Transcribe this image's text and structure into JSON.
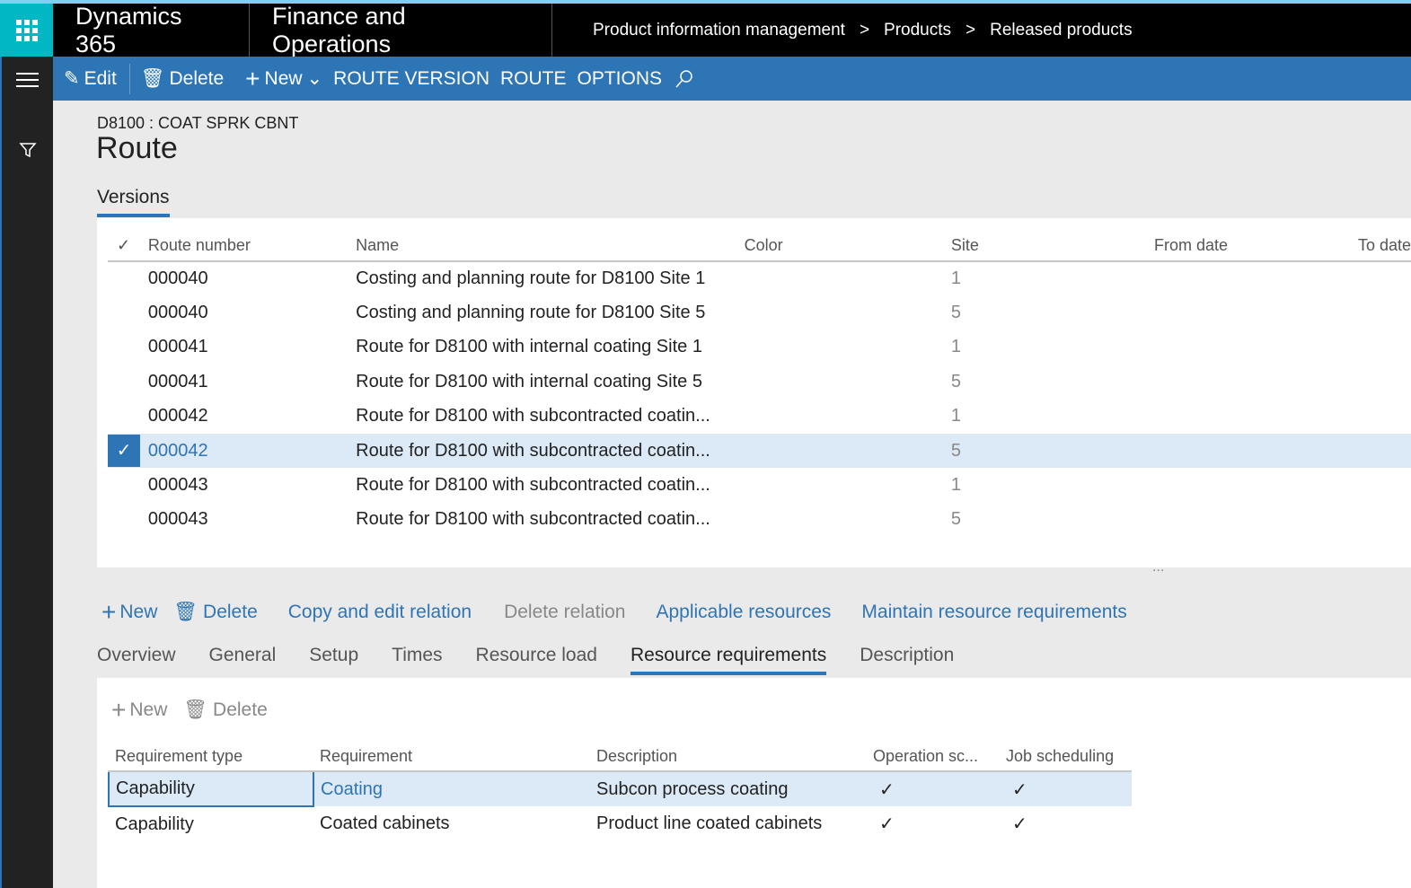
{
  "topbar": {
    "app": "Dynamics 365",
    "module": "Finance and Operations",
    "breadcrumbs": [
      "Product information management",
      "Products",
      "Released products"
    ]
  },
  "actionbar": {
    "edit": "Edit",
    "delete": "Delete",
    "new": "New",
    "route_version": "ROUTE VERSION",
    "route": "ROUTE",
    "options": "OPTIONS"
  },
  "page": {
    "record": "D8100 : COAT SPRK CBNT",
    "title": "Route",
    "section": "Versions"
  },
  "versions": {
    "columns": [
      "Route number",
      "Name",
      "Color",
      "Site",
      "From date",
      "To date"
    ],
    "rows": [
      {
        "number": "000040",
        "name": "Costing and planning route for D8100 Site 1",
        "site": "1"
      },
      {
        "number": "000040",
        "name": "Costing and planning route for D8100 Site 5",
        "site": "5"
      },
      {
        "number": "000041",
        "name": "Route for D8100 with internal coating Site 1",
        "site": "1"
      },
      {
        "number": "000041",
        "name": "Route for D8100 with internal coating Site 5",
        "site": "5"
      },
      {
        "number": "000042",
        "name": "Route for D8100 with subcontracted coatin...",
        "site": "1"
      },
      {
        "number": "000042",
        "name": "Route for D8100 with subcontracted coatin...",
        "site": "5",
        "selected": true
      },
      {
        "number": "000043",
        "name": "Route for D8100 with subcontracted coatin...",
        "site": "1"
      },
      {
        "number": "000043",
        "name": "Route for D8100 with subcontracted coatin...",
        "site": "5"
      }
    ],
    "more": "..."
  },
  "ops_actions": {
    "new": "New",
    "delete": "Delete",
    "copy": "Copy and edit relation",
    "delete_relation": "Delete relation",
    "applicable": "Applicable resources",
    "maintain": "Maintain resource requirements"
  },
  "tabs": [
    "Overview",
    "General",
    "Setup",
    "Times",
    "Resource load",
    "Resource requirements",
    "Description"
  ],
  "req_actions": {
    "new": "New",
    "delete": "Delete"
  },
  "requirements": {
    "columns": [
      "Requirement type",
      "Requirement",
      "Description",
      "Operation sc...",
      "Job scheduling"
    ],
    "rows": [
      {
        "type": "Capability",
        "requirement": "Coating",
        "description": "Subcon process coating",
        "op": "✓",
        "job": "✓"
      },
      {
        "type": "Capability",
        "requirement": "Coated cabinets",
        "description": "Product line coated cabinets",
        "op": "✓",
        "job": "✓"
      }
    ]
  },
  "colors": {
    "accent": "#2e75b6",
    "launcher": "#00b7c3"
  }
}
